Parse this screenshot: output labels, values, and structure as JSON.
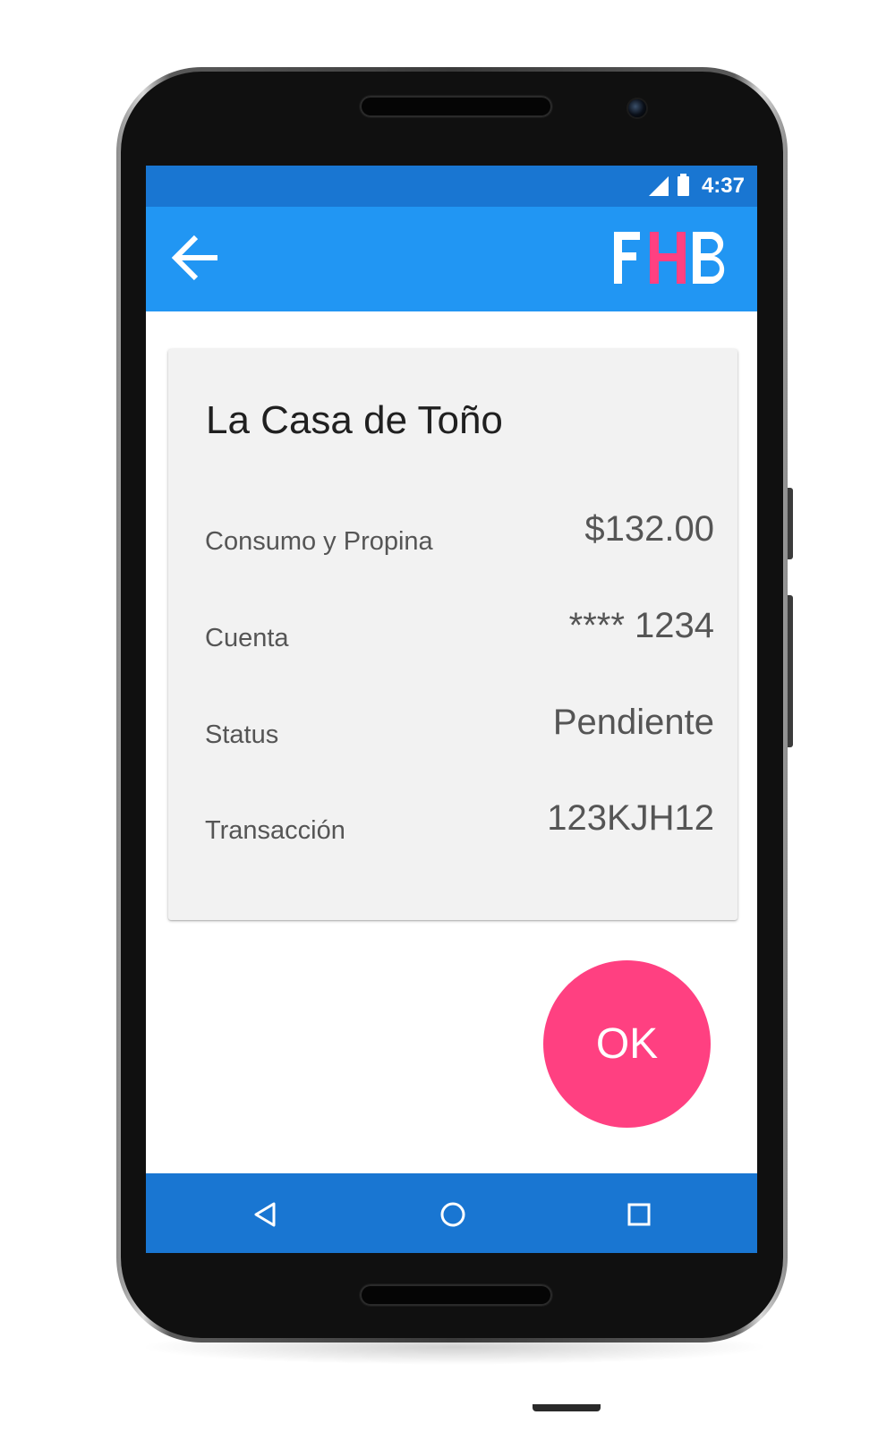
{
  "status_bar": {
    "time": "4:37",
    "icons": [
      "signal-icon",
      "battery-icon"
    ]
  },
  "app_bar": {
    "back_icon": "arrow-back-icon",
    "logo": {
      "letters": [
        "F",
        "H",
        "B"
      ],
      "colors": [
        "#ffffff",
        "#FF4081",
        "#ffffff"
      ]
    }
  },
  "card": {
    "title": "La Casa de Toño",
    "rows": [
      {
        "label": "Consumo y Propina",
        "value": "$132.00"
      },
      {
        "label": "Cuenta",
        "value": "**** 1234"
      },
      {
        "label": "Status",
        "value": "Pendiente"
      },
      {
        "label": "Transacción",
        "value": "123KJH12"
      }
    ]
  },
  "ok_button": {
    "label": "OK"
  },
  "nav_bar": {
    "icons": [
      "back-triangle-icon",
      "home-circle-icon",
      "recents-square-icon"
    ]
  },
  "colors": {
    "primary": "#2196F3",
    "primary_dark": "#1976D2",
    "accent": "#FF4081",
    "card_background": "#f2f2f2"
  }
}
